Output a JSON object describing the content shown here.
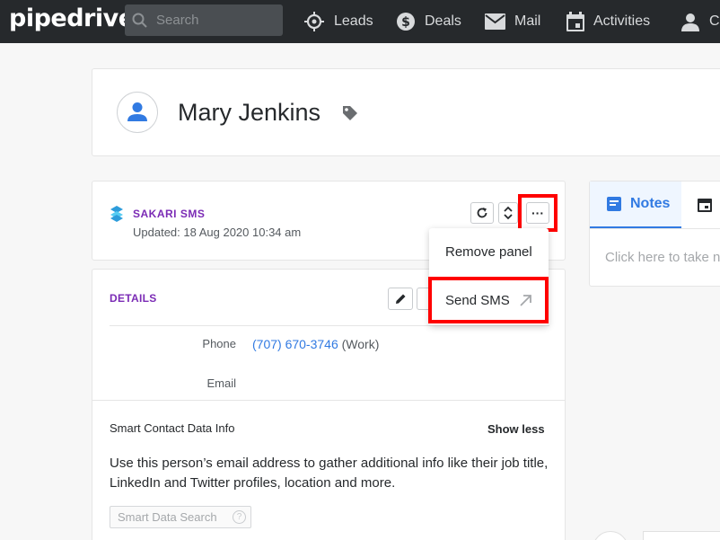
{
  "nav": {
    "logo": "pipedrive",
    "search_placeholder": "Search",
    "items": [
      {
        "label": "Leads",
        "icon": "target-icon"
      },
      {
        "label": "Deals",
        "icon": "dollar-icon"
      },
      {
        "label": "Mail",
        "icon": "mail-icon"
      },
      {
        "label": "Activities",
        "icon": "calendar-icon"
      },
      {
        "label": "C",
        "icon": "contacts-icon"
      }
    ]
  },
  "person": {
    "name": "Mary Jenkins"
  },
  "sakari": {
    "title": "SAKARI SMS",
    "updated": "Updated: 18 Aug 2020 10:34 am",
    "more_label": "···"
  },
  "menu": {
    "remove_panel": "Remove panel",
    "send_sms": "Send SMS"
  },
  "details": {
    "title": "DETAILS",
    "phone_label": "Phone",
    "phone_value": "(707) 670-3746",
    "phone_type": "(Work)",
    "email_label": "Email",
    "smart_title": "Smart Contact Data Info",
    "show_less": "Show less",
    "smart_desc": "Use this person’s email address to gather additional info like their job title, LinkedIn and Twitter profiles, location and more.",
    "smart_button": "Smart Data Search",
    "smart_help": "?"
  },
  "notes": {
    "tab_label": "Notes",
    "placeholder": "Click here to take notes"
  },
  "colors": {
    "nav_bg": "#26292c",
    "accent_purple": "#7b2bb5",
    "link_blue": "#317ae2",
    "highlight_red": "#ff0000"
  }
}
